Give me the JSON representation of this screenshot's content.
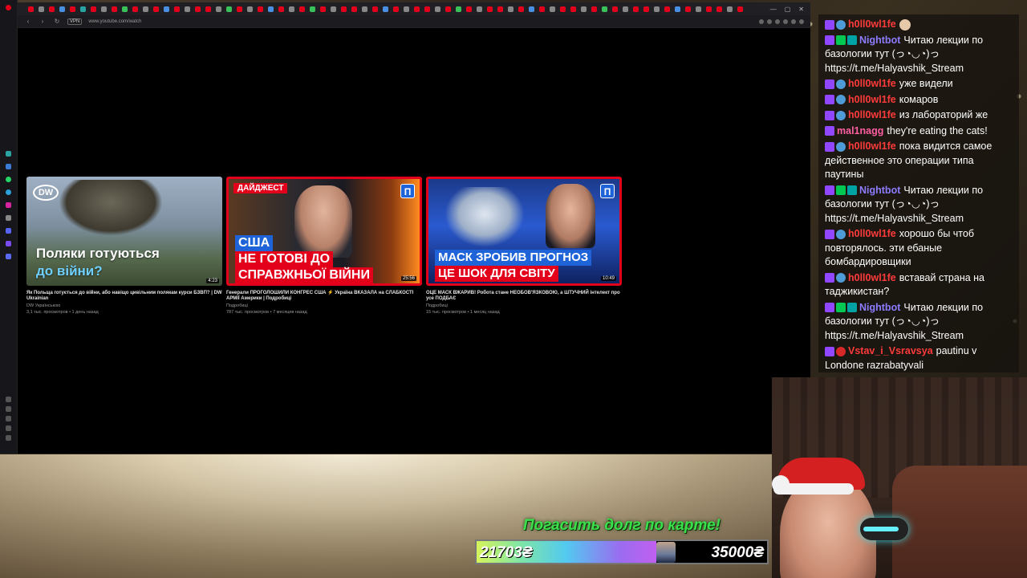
{
  "browser": {
    "url": "www.youtube.com/watch",
    "vpn_label": "VPN"
  },
  "videos": [
    {
      "thumb_caption_line1": "Поляки готуються",
      "thumb_caption_line2": "до війни?",
      "duration": "4:23",
      "title": "Як Польща готується до війни, або навіщо цивільним полякам курси БЗВП? | DW Ukrainian",
      "channel": "DW Українською",
      "meta": "3,1 тыс. просмотров • 1 день назад",
      "logo": "DW"
    },
    {
      "tag": "ДАЙДЖЕСТ",
      "thumb_caption_line1": "США",
      "thumb_caption_line2": "НЕ ГОТОВІ ДО",
      "thumb_caption_line3": "СПРАВЖНЬОЇ ВІЙНИ",
      "badge": "П",
      "duration": "25:56",
      "title": "Генерали ПРОГОЛОШИЛИ КОНГРЕС США ⚡ Україна ВКАЗАЛА на СЛАБКОСТІ АРМІЇ Америки | Подробиці",
      "channel": "Подробиці",
      "meta": "787 тыс. просмотров • 7 месяцев назад"
    },
    {
      "thumb_caption_line1": "МАСК ЗРОБИВ ПРОГНОЗ",
      "thumb_caption_line2": "ЦЕ ШОК ДЛЯ СВІТУ",
      "badge": "П",
      "duration": "10:49",
      "title": "ОЦЕ МАСК ВЖАРИВ! Робота стане НЕОБОВ'ЯЗКОВОЮ, а ШТУЧНИЙ інтелект про усе ПОДБАЄ",
      "channel": "Подробиці",
      "meta": "15 тыс. просмотров • 1 месяц назад"
    }
  ],
  "goal": {
    "title": "Погасить долг по карте!",
    "current": "21703₴",
    "target": "35000₴",
    "progress_fraction": 0.62
  },
  "chat": [
    {
      "user": "h0ll0wl1fe",
      "color": "#ff3b3b",
      "badges": [
        "purple",
        "blue"
      ],
      "text": "",
      "emote": true
    },
    {
      "user": "Nightbot",
      "color": "#8c7cff",
      "badges": [
        "purple",
        "green",
        "teal"
      ],
      "text": "Читаю лекции по базологии тут (っ◔◡◔)っ https://t.me/Halyavshik_Stream"
    },
    {
      "user": "h0ll0wl1fe",
      "color": "#ff3b3b",
      "badges": [
        "purple",
        "blue"
      ],
      "text": "уже видели"
    },
    {
      "user": "h0ll0wl1fe",
      "color": "#ff3b3b",
      "badges": [
        "purple",
        "blue"
      ],
      "text": "комаров"
    },
    {
      "user": "h0ll0wl1fe",
      "color": "#ff3b3b",
      "badges": [
        "purple",
        "blue"
      ],
      "text": "из лабораторий же"
    },
    {
      "user": "mal1nagg",
      "color": "#ff5fa2",
      "badges": [
        "purple"
      ],
      "text": "they're eating the cats!"
    },
    {
      "user": "h0ll0wl1fe",
      "color": "#ff3b3b",
      "badges": [
        "purple",
        "blue"
      ],
      "text": "пока видится самое действенное это операции типа паутины"
    },
    {
      "user": "Nightbot",
      "color": "#8c7cff",
      "badges": [
        "purple",
        "green",
        "teal"
      ],
      "text": "Читаю лекции по базологии тут (っ◔◡◔)っ https://t.me/Halyavshik_Stream"
    },
    {
      "user": "h0ll0wl1fe",
      "color": "#ff3b3b",
      "badges": [
        "purple",
        "blue"
      ],
      "text": "хорошо бы чтоб повторялось. эти ебаные бомбардировщики"
    },
    {
      "user": "h0ll0wl1fe",
      "color": "#ff3b3b",
      "badges": [
        "purple",
        "blue"
      ],
      "text": "вставай страна на таджикистан?"
    },
    {
      "user": "Nightbot",
      "color": "#8c7cff",
      "badges": [
        "purple",
        "green",
        "teal"
      ],
      "text": "Читаю лекции по базологии тут (っ◔◡◔)っ https://t.me/Halyavshik_Stream"
    },
    {
      "user": "Vstav_i_Vsravsya",
      "color": "#ff3b3b",
      "badges": [
        "purple",
        "red"
      ],
      "text": "pautinu v Londone razrabatyvali"
    }
  ]
}
